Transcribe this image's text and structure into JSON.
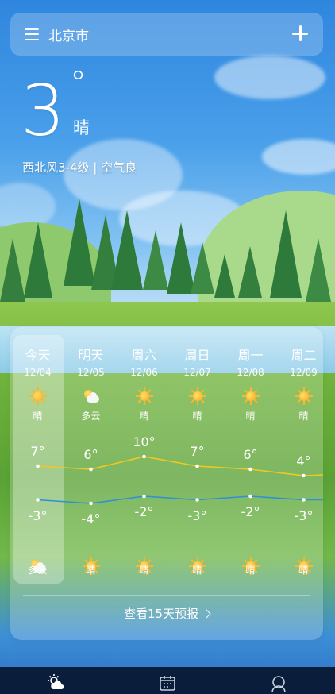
{
  "header": {
    "city": "北京市",
    "menu_icon": "menu-icon",
    "add_icon": "plus-icon"
  },
  "current": {
    "temperature": "3",
    "degree_symbol": "°",
    "condition": "晴",
    "detail": "西北风3-4级 | 空气良"
  },
  "forecast": {
    "days": [
      {
        "name": "今天",
        "date": "12/04",
        "day_icon": "sun-icon",
        "day_cond": "晴",
        "high": "7°",
        "low": "-3°",
        "night_icon": "cloud-sun-icon",
        "night_cond": "多云",
        "high_val": 7,
        "low_val": -3
      },
      {
        "name": "明天",
        "date": "12/05",
        "day_icon": "cloud-sun-icon",
        "day_cond": "多云",
        "high": "6°",
        "low": "-4°",
        "night_icon": "sun-icon",
        "night_cond": "晴",
        "high_val": 6,
        "low_val": -4
      },
      {
        "name": "周六",
        "date": "12/06",
        "day_icon": "sun-icon",
        "day_cond": "晴",
        "high": "10°",
        "low": "-2°",
        "night_icon": "sun-icon",
        "night_cond": "晴",
        "high_val": 10,
        "low_val": -2
      },
      {
        "name": "周日",
        "date": "12/07",
        "day_icon": "sun-icon",
        "day_cond": "晴",
        "high": "7°",
        "low": "-3°",
        "night_icon": "sun-icon",
        "night_cond": "晴",
        "high_val": 7,
        "low_val": -3
      },
      {
        "name": "周一",
        "date": "12/08",
        "day_icon": "sun-icon",
        "day_cond": "晴",
        "high": "6°",
        "low": "-2°",
        "night_icon": "sun-icon",
        "night_cond": "晴",
        "high_val": 6,
        "low_val": -2
      },
      {
        "name": "周二",
        "date": "12/09",
        "day_icon": "sun-icon",
        "day_cond": "晴",
        "high": "4°",
        "low": "-3°",
        "night_icon": "sun-icon",
        "night_cond": "晴",
        "high_val": 4,
        "low_val": -3
      }
    ],
    "more_label": "查看15天预报",
    "high_line_color": "#f2c81f",
    "low_line_color": "#2f8fd8"
  },
  "bottom_nav": {
    "items": [
      {
        "icon": "weather-icon"
      },
      {
        "icon": "calendar-icon"
      },
      {
        "icon": "profile-icon"
      }
    ]
  }
}
